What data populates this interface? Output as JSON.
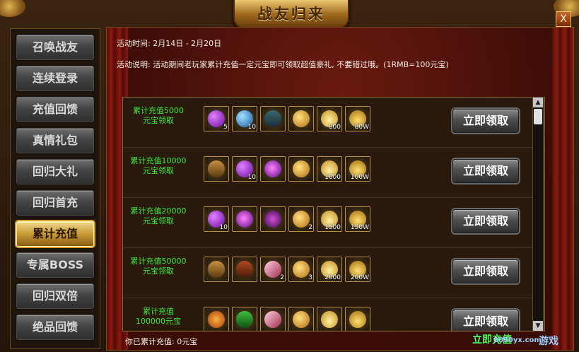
{
  "title": "战友归来",
  "close_label": "X",
  "sidebar": {
    "items": [
      {
        "label": "召唤战友"
      },
      {
        "label": "连续登录"
      },
      {
        "label": "充值回馈"
      },
      {
        "label": "真情礼包"
      },
      {
        "label": "回归大礼"
      },
      {
        "label": "回归首充"
      },
      {
        "label": "累计充值",
        "active": true
      },
      {
        "label": "专属BOSS"
      },
      {
        "label": "回归双倍"
      },
      {
        "label": "绝品回馈"
      }
    ]
  },
  "info": {
    "time": "活动时间: 2月14日 - 2月20日",
    "desc": "活动说明: 活动期间老玩家累计充值一定元宝即可领取超值豪礼, 不要错过哦。(1RMB=100元宝)"
  },
  "rewards": [
    {
      "requirement": "累计充值5000元宝领取",
      "button": "立即领取",
      "items": [
        {
          "icon": "purple-gem-icon",
          "count": "5"
        },
        {
          "icon": "blue-orb-icon",
          "count": "10"
        },
        {
          "icon": "skill-book-icon",
          "count": ""
        },
        {
          "icon": "gold-medal-icon",
          "count": ""
        },
        {
          "icon": "gold-ingot-icon",
          "count": "800"
        },
        {
          "icon": "gold-pile-icon",
          "count": "80W"
        }
      ]
    },
    {
      "requirement": "累计充值10000元宝领取",
      "button": "立即领取",
      "items": [
        {
          "icon": "treasure-chest-icon",
          "count": ""
        },
        {
          "icon": "purple-gem-icon",
          "count": "10"
        },
        {
          "icon": "purple-rune-icon",
          "count": ""
        },
        {
          "icon": "gold-medal-icon",
          "count": ""
        },
        {
          "icon": "gold-ingot-icon",
          "count": "1000"
        },
        {
          "icon": "gold-pile-icon",
          "count": "100W"
        }
      ]
    },
    {
      "requirement": "累计充值20000元宝领取",
      "button": "立即领取",
      "items": [
        {
          "icon": "purple-gem-icon",
          "count": "10"
        },
        {
          "icon": "purple-rune-icon",
          "count": ""
        },
        {
          "icon": "armor-icon",
          "count": ""
        },
        {
          "icon": "gold-medal-icon",
          "count": "2"
        },
        {
          "icon": "gold-ingot-icon",
          "count": "1500"
        },
        {
          "icon": "gold-pile-icon",
          "count": "150W"
        }
      ]
    },
    {
      "requirement": "累计充值50000元宝领取",
      "button": "立即领取",
      "items": [
        {
          "icon": "treasure-chest-icon",
          "count": ""
        },
        {
          "icon": "red-chest-icon",
          "count": ""
        },
        {
          "icon": "feather-icon",
          "count": "2"
        },
        {
          "icon": "gold-medal-icon",
          "count": "3"
        },
        {
          "icon": "gold-ingot-icon",
          "count": "2000"
        },
        {
          "icon": "gold-pile-icon",
          "count": "200W"
        }
      ]
    },
    {
      "requirement": "累计充值100000元宝",
      "button": "立即领取",
      "items": [
        {
          "icon": "gift-icon",
          "count": ""
        },
        {
          "icon": "green-box-icon",
          "count": ""
        },
        {
          "icon": "feather-icon",
          "count": ""
        },
        {
          "icon": "gold-medal-icon",
          "count": ""
        },
        {
          "icon": "gold-ingot-icon",
          "count": ""
        },
        {
          "icon": "gold-pile-icon",
          "count": ""
        }
      ]
    }
  ],
  "total": "你已累计充值: 0元宝",
  "watermark": {
    "text": "立即充值",
    "site": "8090yx.com",
    "game": "游戏"
  },
  "colors": {
    "requirement_text": "#3ee83e",
    "gold": "#c89a36",
    "curtain": "#6a1a10"
  }
}
